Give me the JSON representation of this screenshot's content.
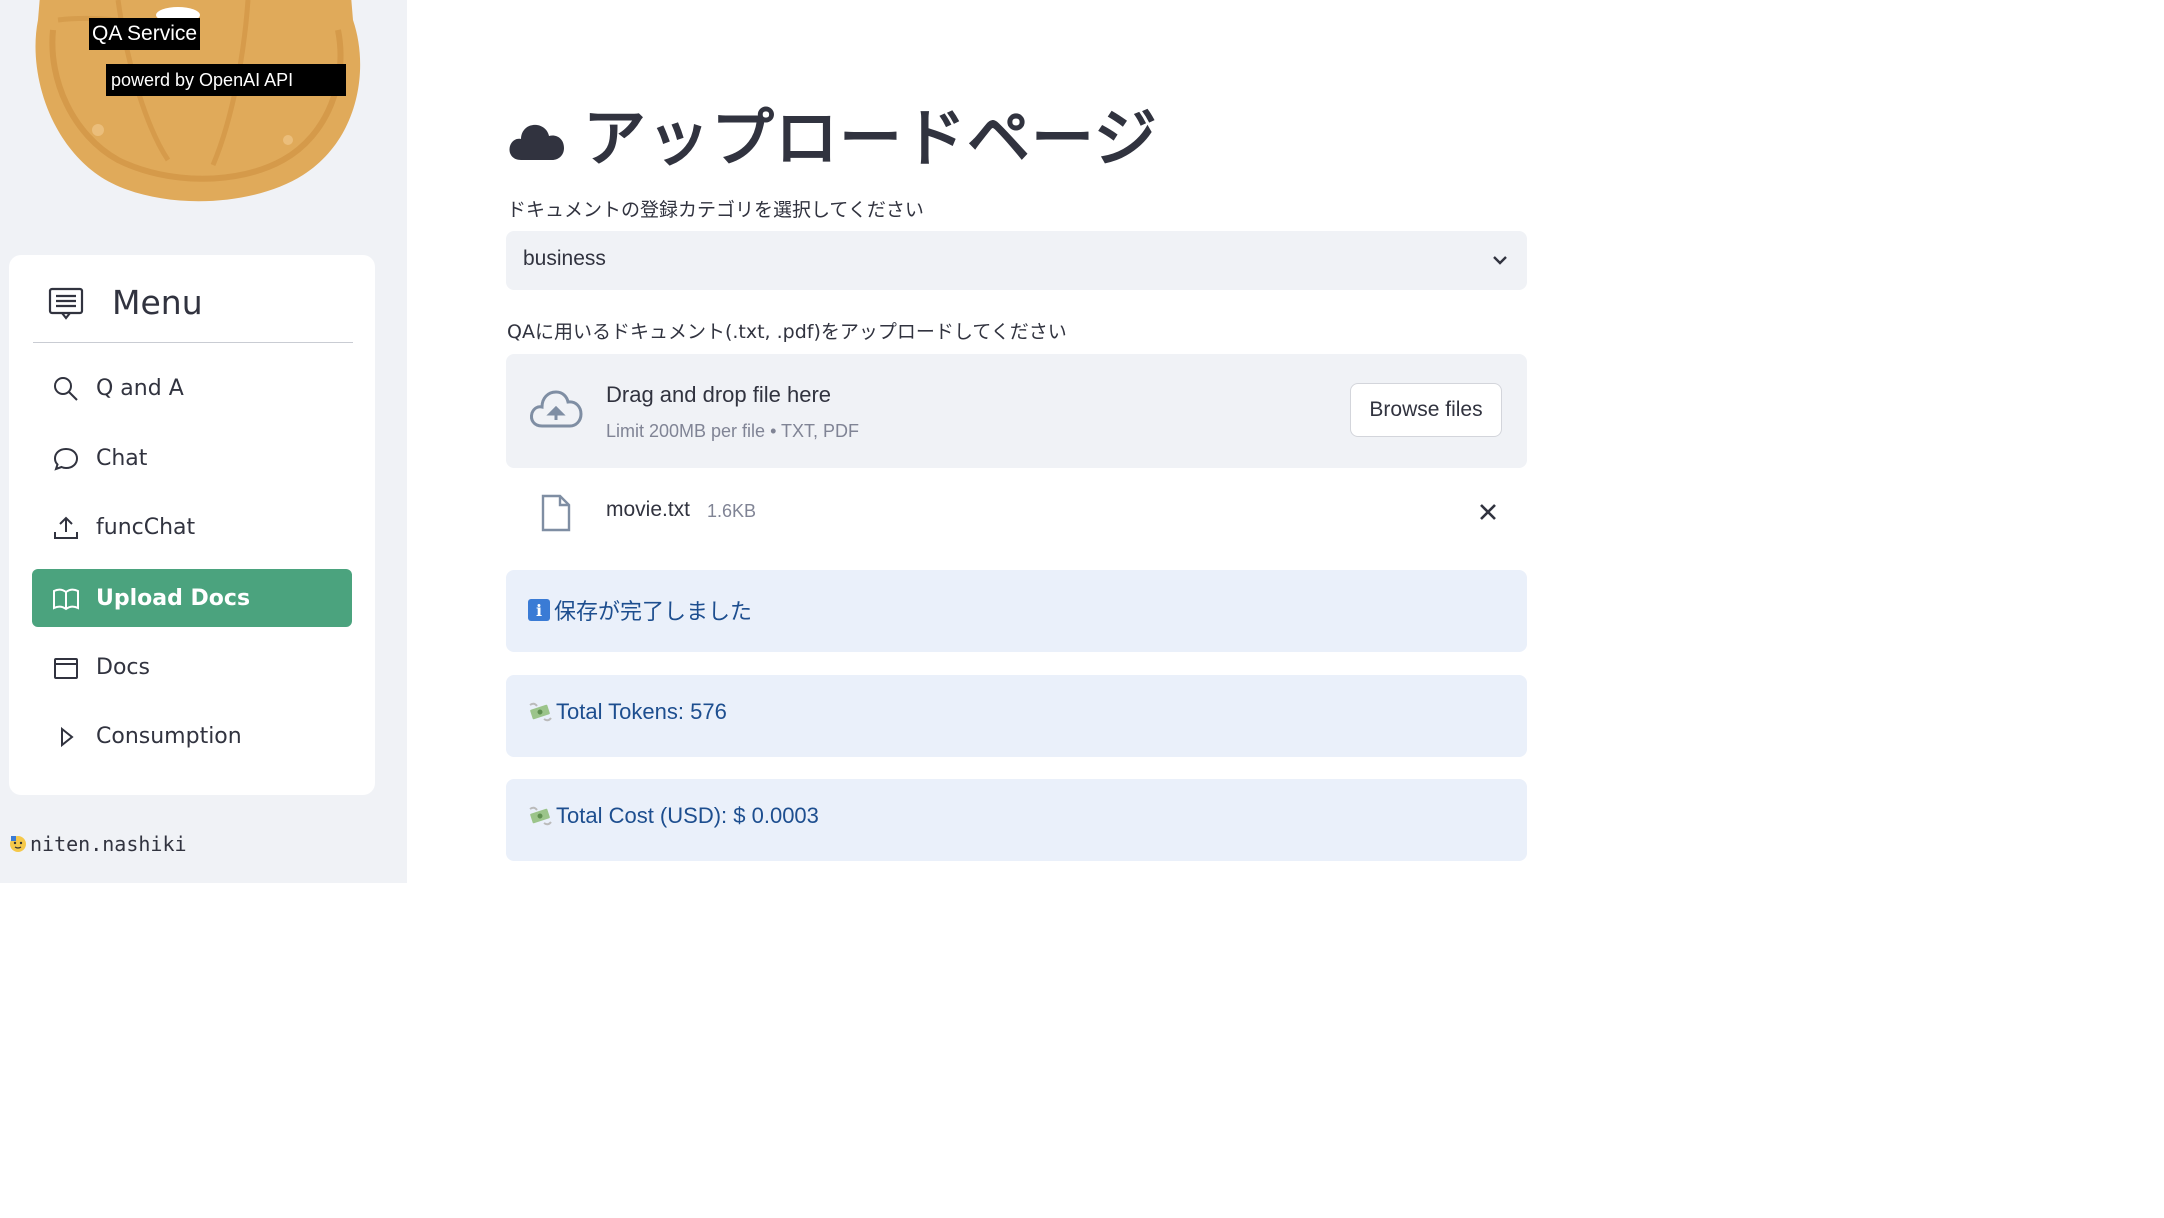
{
  "sidebar": {
    "logo": {
      "caption_line1": "QA Service",
      "caption_line2": "powerd by OpenAI API"
    },
    "menu": {
      "title": "Menu",
      "icon": "menu-list-icon",
      "items": [
        {
          "label": "Q and A",
          "icon": "search-icon",
          "active": false
        },
        {
          "label": "Chat",
          "icon": "chat-bubble-icon",
          "active": false
        },
        {
          "label": "funcChat",
          "icon": "upload-icon",
          "active": false
        },
        {
          "label": "Upload Docs",
          "icon": "book-icon",
          "active": true
        },
        {
          "label": "Docs",
          "icon": "window-icon",
          "active": false
        },
        {
          "label": "Consumption",
          "icon": "play-icon",
          "active": false
        }
      ],
      "active_color": "#4ba37e"
    },
    "user": {
      "name": "niten.nashiki",
      "icon": "person-emoji-icon"
    }
  },
  "main": {
    "title": "アップロードページ",
    "title_icon": "cloud-icon",
    "category": {
      "label": "ドキュメントの登録カテゴリを選択してください",
      "selected": "business"
    },
    "uploader": {
      "label": "QAに用いるドキュメント(.txt, .pdf)をアップロードしてください",
      "drop_text": "Drag and drop file here",
      "limit_text": "Limit 200MB per file • TXT, PDF",
      "browse_label": "Browse files"
    },
    "file": {
      "name": "movie.txt",
      "size": "1.6KB"
    },
    "messages": {
      "saved": "保存が完了しました",
      "tokens": "Total Tokens: 576",
      "cost": "Total Cost (USD): $ 0.0003"
    },
    "colors": {
      "alert_bg": "#eaf0fa",
      "alert_text": "#1d4e8f"
    }
  }
}
